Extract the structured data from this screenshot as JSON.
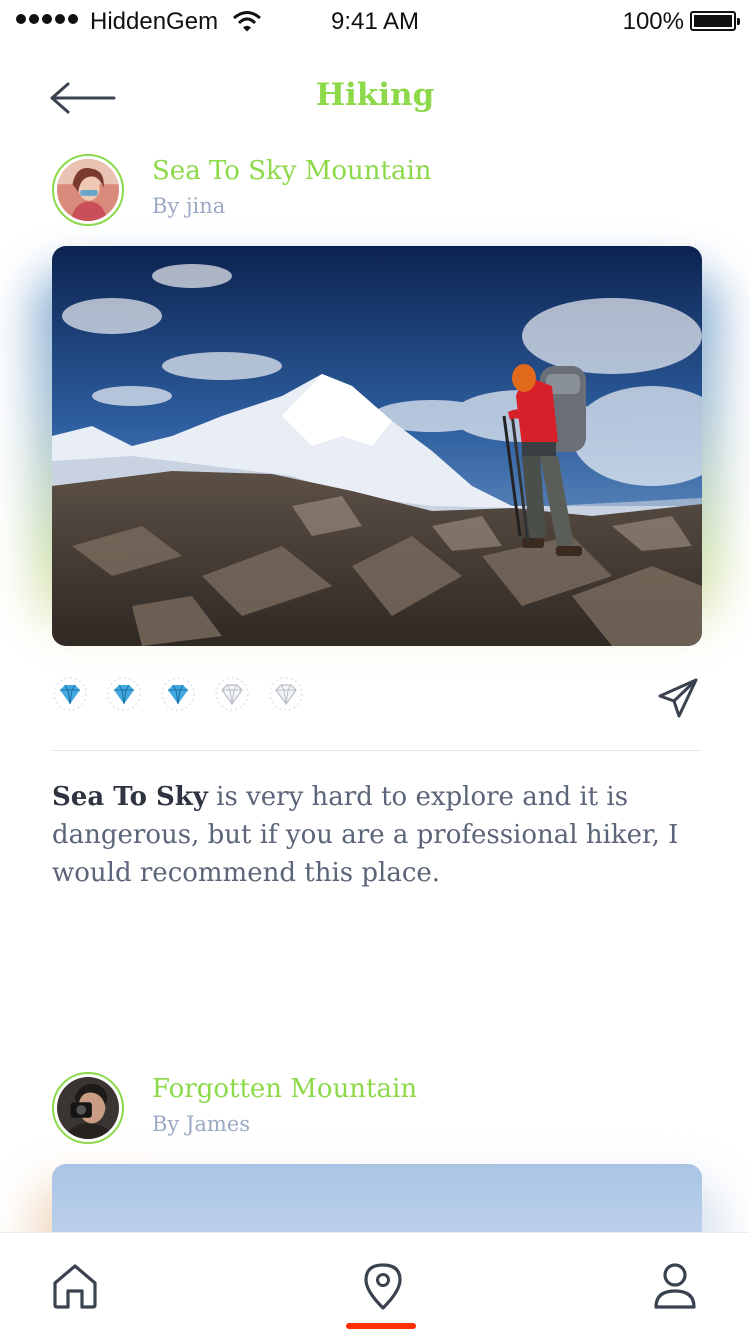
{
  "status_bar": {
    "carrier": "HiddenGem",
    "time": "9:41 AM",
    "battery": "100%"
  },
  "header": {
    "title": "Hiking",
    "back_icon": "arrow-left-icon"
  },
  "posts": [
    {
      "title": "Sea To Sky Mountain",
      "author": "By jina",
      "rating": {
        "value": 3,
        "max": 5,
        "icon": "diamond-icon",
        "filled_color": "#3fa9e0",
        "empty_color": "#b9bec7"
      },
      "description_bold": "Sea To Sky",
      "description_rest": " is very hard to explore and it is dangerous, but if you are a professional hiker, I would recommend this place."
    },
    {
      "title": "Forgotten Mountain",
      "author": "By James"
    }
  ],
  "share_icon": "paper-plane-icon",
  "tab_bar": {
    "tabs": [
      "home-icon",
      "map-pin-icon",
      "user-icon"
    ],
    "active": "map-pin-icon",
    "active_color": "#ff2d00"
  },
  "colors": {
    "accent": "#8cd94a",
    "muted": "#9ba9c4",
    "body_text": "#5b6478"
  }
}
